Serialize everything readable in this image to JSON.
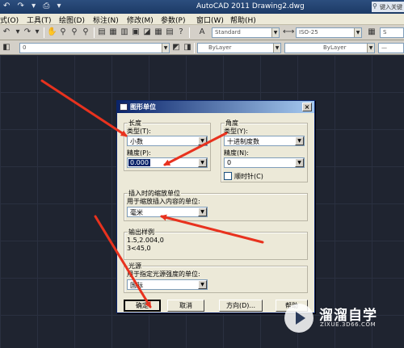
{
  "titlebar": {
    "title": "AutoCAD 2011   Drawing2.dwg",
    "search_placeholder": "键入关键"
  },
  "menu": [
    "式(O)",
    "工具(T)",
    "绘图(D)",
    "标注(N)",
    "修改(M)",
    "参数(P)",
    "窗口(W)",
    "帮助(H)"
  ],
  "toolbar": {
    "text_style": "Standard",
    "dim_style": "ISO-25",
    "layer": "0",
    "color": "ByLayer",
    "linetype": "ByLayer"
  },
  "dialog": {
    "title": "图形单位",
    "close_glyph": "×",
    "length": {
      "group_title": "长度",
      "type_label": "类型(T):",
      "type_value": "小数",
      "precision_label": "精度(P):",
      "precision_value": "0.000"
    },
    "angle": {
      "group_title": "角度",
      "type_label": "类型(Y):",
      "type_value": "十进制度数",
      "precision_label": "精度(N):",
      "precision_value": "0",
      "clockwise_label": "顺时针(C)",
      "clockwise_checked": false
    },
    "insert_scale": {
      "group_title": "插入时的缩放单位",
      "units_label": "用于缩放插入内容的单位:",
      "units_value": "毫米"
    },
    "sample": {
      "group_title": "输出样例",
      "line1": "1.5,2.004,0",
      "line2": "3<45,0"
    },
    "lighting": {
      "group_title": "光源",
      "units_label": "用于指定光源强度的单位:",
      "units_value": "国际"
    },
    "buttons": {
      "ok": "确定",
      "cancel": "取消",
      "direction": "方向(D)...",
      "help": "帮助"
    }
  },
  "watermark": {
    "name": "溜溜自学",
    "url": "ZIXUE.3D66.COM"
  },
  "colors": {
    "arrow": "#e8321e",
    "canvas": "#1f2430",
    "dialog_bg": "#ece9d8",
    "selection": "#0a246a"
  }
}
